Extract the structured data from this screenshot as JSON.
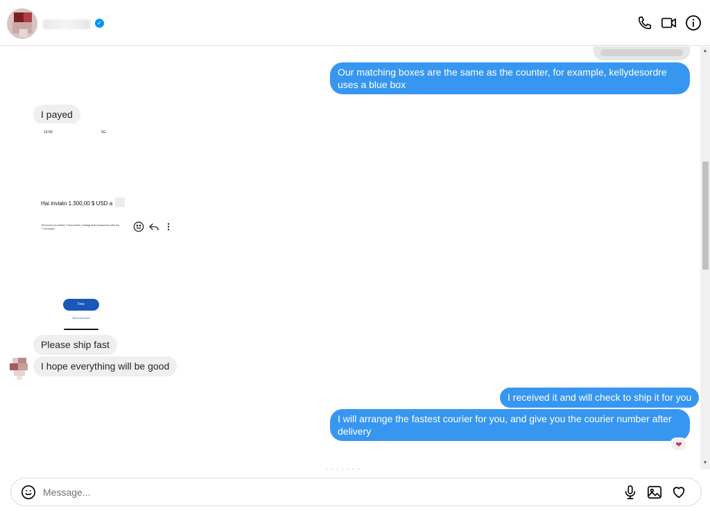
{
  "header": {
    "verified_mark": "✓",
    "icons": [
      "phone-icon",
      "video-camera-icon",
      "info-icon"
    ]
  },
  "messages": [
    {
      "id": "m1",
      "direction": "outgoing",
      "text": "Our matching boxes are the same as the counter, for example, kellydesordre uses a blue box"
    },
    {
      "id": "m2",
      "direction": "incoming",
      "text": "I payed"
    },
    {
      "id": "m3",
      "direction": "incoming",
      "type": "image",
      "screenshot": {
        "time": "16:59",
        "status": "5G",
        "amount_text": "Hai inviato 1.300,00 $ USD a",
        "note_text": "Riceverai una notifica. Potrai vedere i dettagli della transazione nella tua \"Cronologia\".",
        "button_label": "Fine",
        "link_label": "Ricevuta Invio"
      }
    },
    {
      "id": "m4",
      "direction": "incoming",
      "text": "Please ship fast"
    },
    {
      "id": "m5",
      "direction": "incoming",
      "text": "I hope everything will be good"
    },
    {
      "id": "m6",
      "direction": "outgoing",
      "text": "I received it and will check to ship it for you"
    },
    {
      "id": "m7",
      "direction": "outgoing",
      "text": "I will arrange the fastest courier for you, and give you the courier number after delivery",
      "reaction": "❤"
    }
  ],
  "message_actions": [
    "smiley-icon",
    "reply-icon",
    "more-icon"
  ],
  "composer": {
    "placeholder": "Message...",
    "icons": [
      "emoji-icon",
      "microphone-icon",
      "image-icon",
      "heart-icon"
    ]
  },
  "colors": {
    "outgoing_bubble": "#3797f0",
    "incoming_bubble": "#efefef",
    "border": "#dbdbdb"
  }
}
